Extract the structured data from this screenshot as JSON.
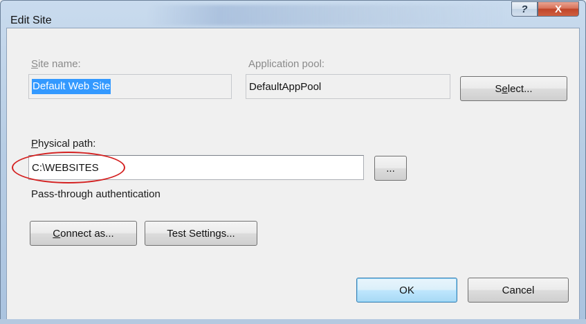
{
  "window": {
    "title": "Edit Site",
    "help_glyph": "?",
    "close_glyph": "X"
  },
  "site_name": {
    "label_access": "S",
    "label_rest": "ite name:",
    "value": "Default Web Site"
  },
  "app_pool": {
    "label": "Application pool:",
    "value": "DefaultAppPool"
  },
  "select_button": {
    "label_pre": "S",
    "label_access": "e",
    "label_post": "lect..."
  },
  "physical_path": {
    "label_access": "P",
    "label_rest": "hysical path:",
    "value": "C:\\WEBSITES",
    "browse_label": "...",
    "highlight_color": "#d42020"
  },
  "auth_text": "Pass-through authentication",
  "connect_button": {
    "label_access": "C",
    "label_rest": "onnect as..."
  },
  "test_button": {
    "label_pre": "Test Settin",
    "label_access": "g",
    "label_post": "s..."
  },
  "ok_button": {
    "label": "OK"
  },
  "cancel_button": {
    "label": "Cancel"
  },
  "colors": {
    "selection": "#3399ff",
    "close_button": "#c0452a",
    "default_button_border": "#3c7fb1"
  }
}
